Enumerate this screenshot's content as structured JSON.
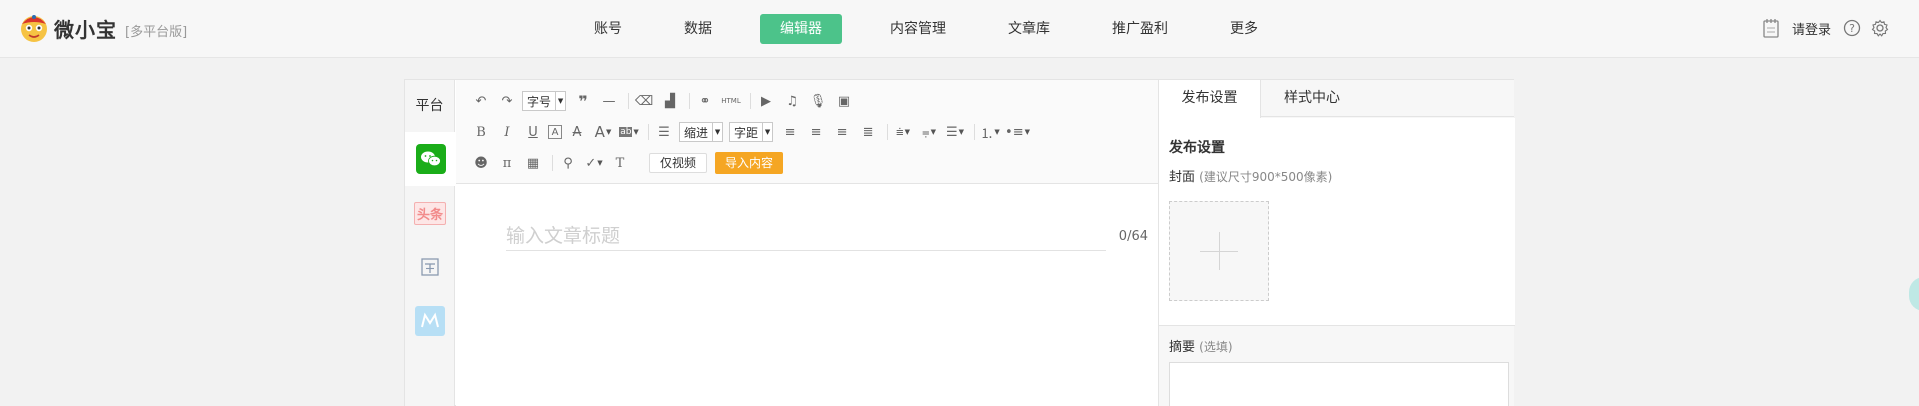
{
  "header": {
    "logo_text": "微小宝",
    "edition": "[多平台版]",
    "nav": [
      "账号",
      "数据",
      "编辑器",
      "内容管理",
      "文章库",
      "推广盈利",
      "更多"
    ],
    "active_nav_index": 2,
    "login": "请登录"
  },
  "colors": {
    "accent": "#4cc38a",
    "import": "#f5a623",
    "wechat": "#1aad19"
  },
  "platforms": {
    "title": "平台",
    "items": [
      "wechat-icon",
      "toutiao-icon",
      "baijia-icon",
      "m-icon"
    ],
    "toutiao_text": "头条"
  },
  "toolbar": {
    "font_size": "字号",
    "indent": "缩进",
    "spacing": "字距",
    "html": "HTML",
    "video_only": "仅视频",
    "import": "导入内容"
  },
  "editor": {
    "title_placeholder": "输入文章标题",
    "char_count": "0/64"
  },
  "settings": {
    "tabs": [
      "发布设置",
      "样式中心"
    ],
    "heading": "发布设置",
    "cover_label": "封面",
    "cover_hint": "(建议尺寸900*500像素)",
    "summary_label": "摘要",
    "summary_hint": "(选填)"
  }
}
